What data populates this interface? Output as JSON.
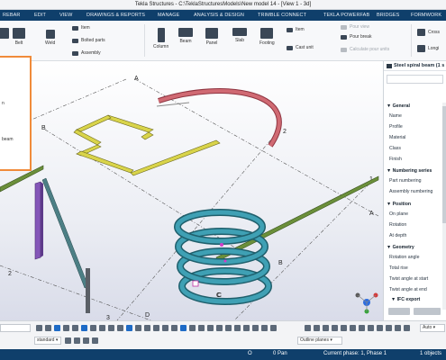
{
  "window": {
    "title": "Tekla Structures - C:\\TeklaStructuresModels\\New model 14  - [View 1 - 3d]"
  },
  "menu": {
    "tabs": [
      "REBAR",
      "EDIT",
      "VIEW",
      "DRAWINGS & REPORTS",
      "MANAGE",
      "ANALYSIS & DESIGN",
      "TRIMBLE CONNECT",
      "TEKLA POWERFAB",
      "BRIDGES",
      "FORMWORK"
    ]
  },
  "ribbon": {
    "belt": "Belt",
    "weld": "Weld",
    "item": "Item",
    "bolted_parts": "Bolted parts",
    "assembly": "Assembly",
    "column": "Column",
    "beam": "Beam",
    "panel": "Panel",
    "slab": "Slab",
    "footing": "Footing",
    "item2": "Item",
    "cast_unit": "Cast unit",
    "pour_view": "Pour view",
    "pour_break": "Pour break",
    "calculate_pour_units": "Calculate pour units",
    "cross": "Cross",
    "longi": "Longi"
  },
  "flyout": {
    "item_1": "n",
    "item_2": "beam"
  },
  "viewport": {
    "grid_labels": [
      "A",
      "B",
      "C",
      "D",
      "1",
      "2",
      "3",
      "A",
      "B",
      "C",
      "2"
    ],
    "colors": {
      "spiral": "#2f8fa3",
      "curved_beam": "#c7606a",
      "zigzag_beam": "#d7d446",
      "slab_edge": "#4f6e2a",
      "column": "#7a4fae",
      "brace": "#3f6f73"
    }
  },
  "properties": {
    "header": "Steel spiral beam (1 s",
    "sections": {
      "general": "General",
      "numbering": "Numbering series",
      "position": "Position",
      "geometry": "Geometry",
      "ifc": "IFC export"
    },
    "general_rows": [
      "Name",
      "Profile",
      "Material",
      "Class",
      "Finish"
    ],
    "numbering_rows": [
      "Part numbering",
      "Assembly numbering"
    ],
    "position_rows": [
      "On plane",
      "Rotation",
      "At depth"
    ],
    "geometry_rows": [
      "Rotation angle",
      "Total rise",
      "Twist angle at start",
      "Twist angle at end"
    ]
  },
  "toolbar": {
    "standard": "standard",
    "outline_planes": "Outline planes",
    "auto": "Auto"
  },
  "status": {
    "o": "O",
    "pan": "0 Pan",
    "current_phase": "Current phase: 1, Phase 1",
    "objects": "1 objects"
  }
}
